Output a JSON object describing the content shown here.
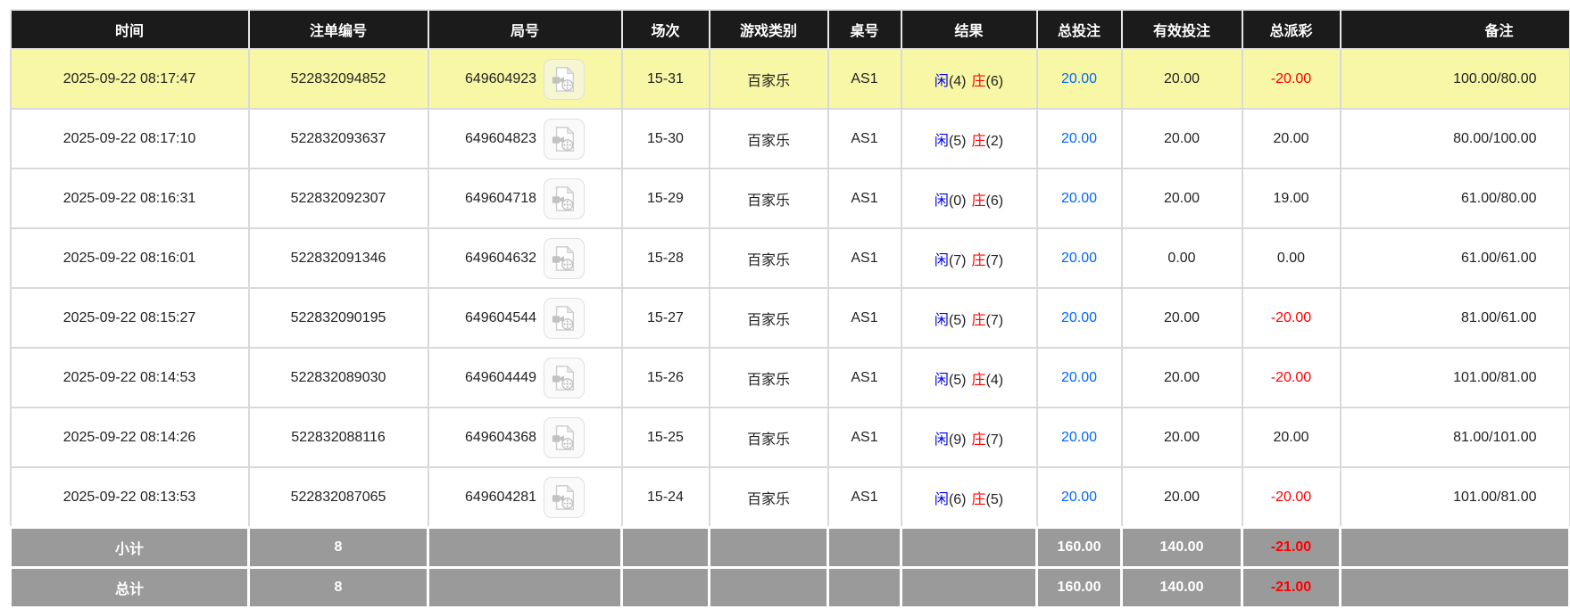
{
  "table": {
    "columns": [
      {
        "label": "时间"
      },
      {
        "label": "注单编号"
      },
      {
        "label": "局号"
      },
      {
        "label": "场次"
      },
      {
        "label": "游戏类别"
      },
      {
        "label": "桌号"
      },
      {
        "label": "结果"
      },
      {
        "label": "总投注"
      },
      {
        "label": "有效投注"
      },
      {
        "label": "总派彩"
      },
      {
        "label": "备注"
      }
    ],
    "rows": [
      {
        "time": "2025-09-22 08:17:47",
        "bet_id": "522832094852",
        "round_no": "649604923",
        "session": "15-31",
        "game_type": "百家乐",
        "table_no": "AS1",
        "result": {
          "player": "闲",
          "player_pts": "(4)",
          "banker": "庄",
          "banker_pts": "(6)"
        },
        "total_bet": "20.00",
        "valid_bet": "20.00",
        "total_payout": "-20.00",
        "remark": "100.00/80.00",
        "highlighted": true
      },
      {
        "time": "2025-09-22 08:17:10",
        "bet_id": "522832093637",
        "round_no": "649604823",
        "session": "15-30",
        "game_type": "百家乐",
        "table_no": "AS1",
        "result": {
          "player": "闲",
          "player_pts": "(5)",
          "banker": "庄",
          "banker_pts": "(2)"
        },
        "total_bet": "20.00",
        "valid_bet": "20.00",
        "total_payout": "20.00",
        "remark": "80.00/100.00",
        "highlighted": false
      },
      {
        "time": "2025-09-22 08:16:31",
        "bet_id": "522832092307",
        "round_no": "649604718",
        "session": "15-29",
        "game_type": "百家乐",
        "table_no": "AS1",
        "result": {
          "player": "闲",
          "player_pts": "(0)",
          "banker": "庄",
          "banker_pts": "(6)"
        },
        "total_bet": "20.00",
        "valid_bet": "20.00",
        "total_payout": "19.00",
        "remark": "61.00/80.00",
        "highlighted": false
      },
      {
        "time": "2025-09-22 08:16:01",
        "bet_id": "522832091346",
        "round_no": "649604632",
        "session": "15-28",
        "game_type": "百家乐",
        "table_no": "AS1",
        "result": {
          "player": "闲",
          "player_pts": "(7)",
          "banker": "庄",
          "banker_pts": "(7)"
        },
        "total_bet": "20.00",
        "valid_bet": "0.00",
        "total_payout": "0.00",
        "remark": "61.00/61.00",
        "highlighted": false
      },
      {
        "time": "2025-09-22 08:15:27",
        "bet_id": "522832090195",
        "round_no": "649604544",
        "session": "15-27",
        "game_type": "百家乐",
        "table_no": "AS1",
        "result": {
          "player": "闲",
          "player_pts": "(5)",
          "banker": "庄",
          "banker_pts": "(7)"
        },
        "total_bet": "20.00",
        "valid_bet": "20.00",
        "total_payout": "-20.00",
        "remark": "81.00/61.00",
        "highlighted": false
      },
      {
        "time": "2025-09-22 08:14:53",
        "bet_id": "522832089030",
        "round_no": "649604449",
        "session": "15-26",
        "game_type": "百家乐",
        "table_no": "AS1",
        "result": {
          "player": "闲",
          "player_pts": "(5)",
          "banker": "庄",
          "banker_pts": "(4)"
        },
        "total_bet": "20.00",
        "valid_bet": "20.00",
        "total_payout": "-20.00",
        "remark": "101.00/81.00",
        "highlighted": false
      },
      {
        "time": "2025-09-22 08:14:26",
        "bet_id": "522832088116",
        "round_no": "649604368",
        "session": "15-25",
        "game_type": "百家乐",
        "table_no": "AS1",
        "result": {
          "player": "闲",
          "player_pts": "(9)",
          "banker": "庄",
          "banker_pts": "(7)"
        },
        "total_bet": "20.00",
        "valid_bet": "20.00",
        "total_payout": "20.00",
        "remark": "81.00/101.00",
        "highlighted": false
      },
      {
        "time": "2025-09-22 08:13:53",
        "bet_id": "522832087065",
        "round_no": "649604281",
        "session": "15-24",
        "game_type": "百家乐",
        "table_no": "AS1",
        "result": {
          "player": "闲",
          "player_pts": "(6)",
          "banker": "庄",
          "banker_pts": "(5)"
        },
        "total_bet": "20.00",
        "valid_bet": "20.00",
        "total_payout": "-20.00",
        "remark": "101.00/81.00",
        "highlighted": false
      }
    ],
    "summary": [
      {
        "label": "小计",
        "count": "8",
        "total_bet": "160.00",
        "valid_bet": "140.00",
        "total_payout": "-21.00"
      },
      {
        "label": "总计",
        "count": "8",
        "total_bet": "160.00",
        "valid_bet": "140.00",
        "total_payout": "-21.00"
      }
    ]
  },
  "icons": {
    "round_video": "video-file-icon"
  },
  "colors": {
    "header_bg": "#1b1b1b",
    "highlight_row": "#f7f7a6",
    "summary_bg": "#9a9a9a",
    "bet_link_blue": "#0066ff",
    "player_blue": "#0000ee",
    "banker_red": "#ff0000",
    "negative_red": "#ff0000"
  }
}
